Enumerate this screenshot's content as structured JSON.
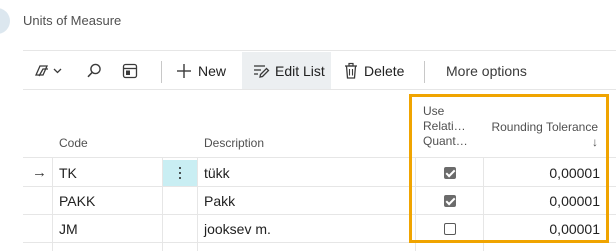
{
  "page": {
    "title": "Units of Measure"
  },
  "toolbar": {
    "new_label": "New",
    "edit_list_label": "Edit List",
    "delete_label": "Delete",
    "more_options_label": "More options"
  },
  "grid": {
    "columns": {
      "code": "Code",
      "description": "Description",
      "use_relational_line1": "Use",
      "use_relational_line2": "Relati…",
      "use_relational_line3": "Quant…",
      "rounding_tolerance": "Rounding Tolerance",
      "sort_indicator": "↓"
    },
    "selected_row_marker": "→",
    "rows": [
      {
        "code": "TK",
        "description": "tükk",
        "use_relational": true,
        "rounding_tolerance": "0,00001"
      },
      {
        "code": "PAKK",
        "description": "Pakk",
        "use_relational": true,
        "rounding_tolerance": "0,00001"
      },
      {
        "code": "JM",
        "description": "jooksev m.",
        "use_relational": false,
        "rounding_tolerance": "0,00001"
      }
    ]
  },
  "colors": {
    "highlight": "#f0a400",
    "selected_cell": "#c9eef3"
  }
}
